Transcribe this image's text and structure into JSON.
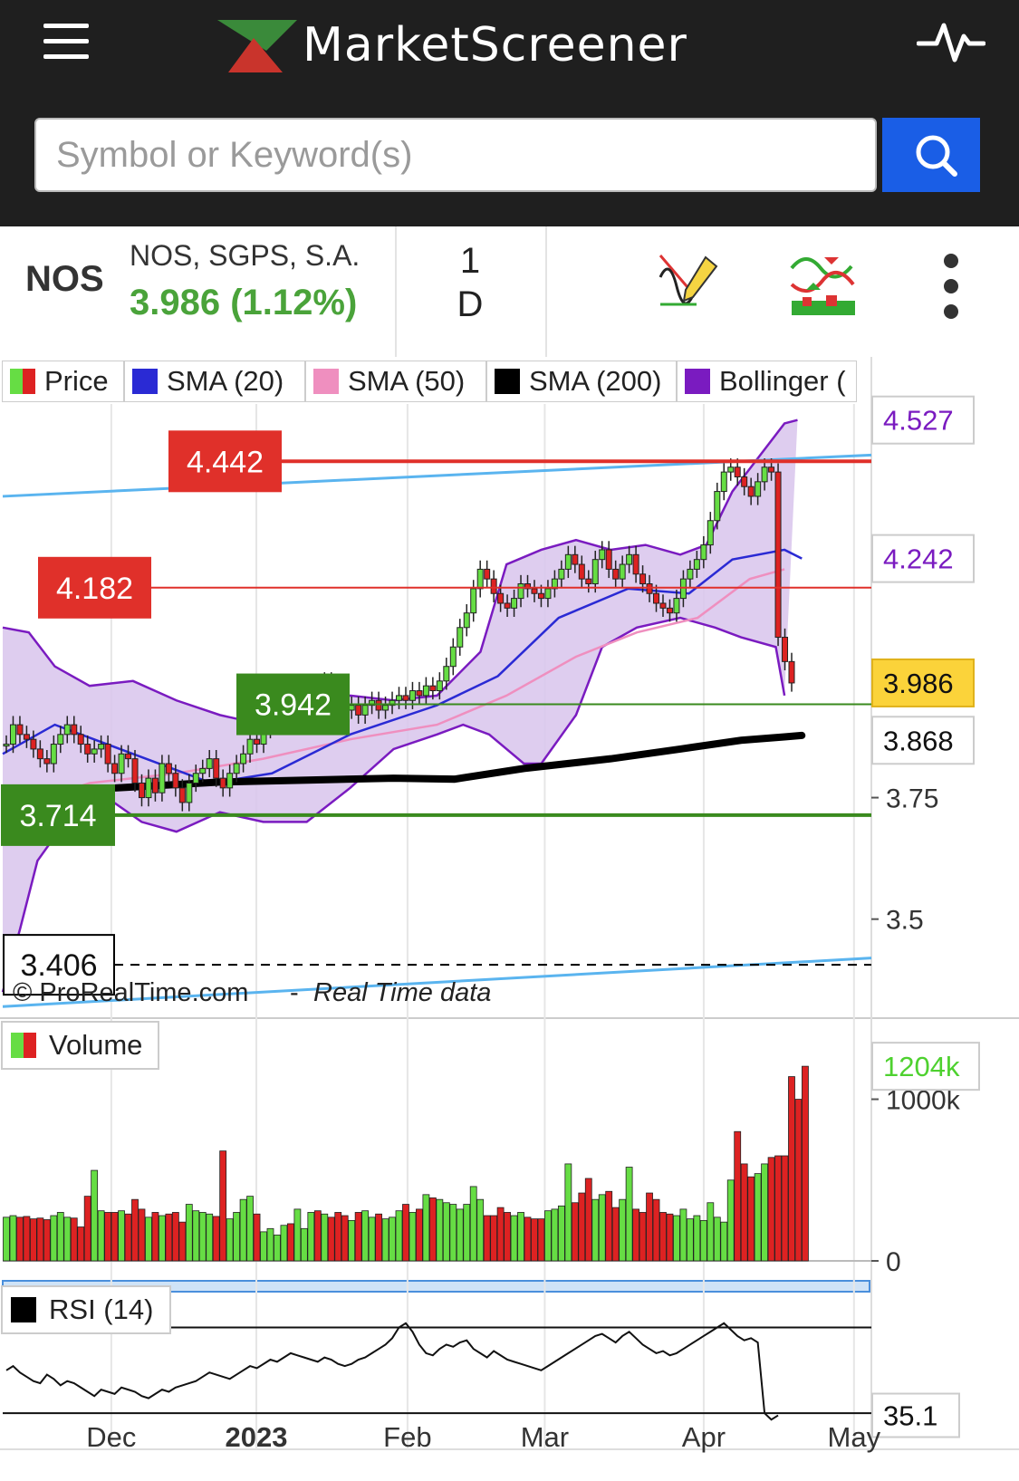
{
  "header": {
    "brand": "MarketScreener",
    "search_placeholder": "Symbol or Keyword(s)"
  },
  "instrument": {
    "ticker": "NOS",
    "name": "NOS, SGPS, S.A.",
    "price_change": "3.986 (1.12%)",
    "period_top": "1",
    "period_bottom": "D"
  },
  "legend": [
    "Price",
    "SMA (20)",
    "SMA (50)",
    "SMA (200)",
    "Bollinger ("
  ],
  "colors": {
    "up": "#66dd44",
    "down": "#dd2222",
    "sma20": "#2a2ad4",
    "sma50": "#ef8fbf",
    "sma200": "#000000",
    "bollinger": "#7a1bc0",
    "band_fill": "#d8c4ec",
    "channel": "#5ab4ef",
    "resistance": "#e0302a",
    "support": "#3a8a1e",
    "accent": "#1a5ee6"
  },
  "watermark": {
    "copyright": "© ProRealTime.com",
    "dash": "-",
    "realtime": "Real Time data"
  },
  "volume_label": "Volume",
  "rsi_label": "RSI (14)",
  "icons": [
    "menu-icon",
    "pulse-icon",
    "search-icon",
    "drawing-tool-icon",
    "indicators-icon",
    "more-vertical-icon"
  ],
  "chart_data": {
    "type": "candlestick",
    "price": {
      "ylim": [
        3.3,
        4.56
      ],
      "y_ticks": [
        {
          "v": 3.75,
          "label": "3.75"
        },
        {
          "v": 3.5,
          "label": "3.5"
        }
      ],
      "right_labels": [
        {
          "v": 4.527,
          "label": "4.527",
          "kind": "bollinger"
        },
        {
          "v": 4.242,
          "label": "4.242",
          "kind": "bollinger"
        },
        {
          "v": 3.986,
          "label": "3.986",
          "kind": "last"
        },
        {
          "v": 3.868,
          "label": "3.868",
          "kind": "plain"
        }
      ],
      "levels": [
        {
          "v": 4.442,
          "label": "4.442",
          "kind": "resistance",
          "tag_from": 187,
          "tag_to": 310,
          "line_from": 310,
          "width": 4
        },
        {
          "v": 4.182,
          "label": "4.182",
          "kind": "resistance",
          "tag_from": 43,
          "tag_to": 166,
          "line_from": 166,
          "width": 2
        },
        {
          "v": 3.942,
          "label": "3.942",
          "kind": "support",
          "tag_from": 262,
          "tag_to": 385,
          "line_from": 385,
          "width": 2
        },
        {
          "v": 3.714,
          "label": "3.714",
          "kind": "support",
          "tag_from": 2,
          "tag_to": 126,
          "line_from": 126,
          "width": 4
        },
        {
          "v": 3.406,
          "label": "3.406",
          "kind": "dashed",
          "tag_from": 4,
          "tag_to": 126,
          "line_from": 126,
          "width": 2
        }
      ],
      "channel_upper": [
        [
          0,
          4.37
        ],
        [
          1,
          4.455
        ]
      ],
      "channel_lower": [
        [
          0,
          3.32
        ],
        [
          1,
          3.42
        ]
      ]
    },
    "x_labels": [
      {
        "t": 0.125,
        "label": "Dec",
        "bold": false
      },
      {
        "t": 0.292,
        "label": "2023",
        "bold": true
      },
      {
        "t": 0.466,
        "label": "Feb",
        "bold": false
      },
      {
        "t": 0.624,
        "label": "Mar",
        "bold": false
      },
      {
        "t": 0.807,
        "label": "Apr",
        "bold": false
      },
      {
        "t": 0.98,
        "label": "May",
        "bold": false
      }
    ],
    "closes": [
      3.86,
      3.9,
      3.88,
      3.87,
      3.85,
      3.83,
      3.82,
      3.86,
      3.88,
      3.9,
      3.88,
      3.86,
      3.84,
      3.85,
      3.86,
      3.82,
      3.8,
      3.84,
      3.83,
      3.78,
      3.75,
      3.79,
      3.76,
      3.82,
      3.8,
      3.77,
      3.74,
      3.78,
      3.8,
      3.81,
      3.83,
      3.79,
      3.77,
      3.8,
      3.82,
      3.84,
      3.87,
      3.86,
      3.89,
      3.9,
      3.91,
      3.93,
      3.92,
      3.94,
      3.96,
      3.98,
      3.97,
      3.99,
      3.98,
      3.95,
      3.93,
      3.94,
      3.92,
      3.94,
      3.95,
      3.93,
      3.94,
      3.95,
      3.96,
      3.95,
      3.97,
      3.96,
      3.98,
      3.97,
      3.99,
      4.02,
      4.06,
      4.1,
      4.13,
      4.18,
      4.22,
      4.2,
      4.17,
      4.15,
      4.14,
      4.16,
      4.19,
      4.18,
      4.17,
      4.16,
      4.18,
      4.2,
      4.22,
      4.25,
      4.23,
      4.2,
      4.19,
      4.24,
      4.26,
      4.22,
      4.2,
      4.23,
      4.25,
      4.21,
      4.19,
      4.17,
      4.15,
      4.14,
      4.13,
      4.16,
      4.2,
      4.22,
      4.24,
      4.27,
      4.32,
      4.38,
      4.42,
      4.43,
      4.41,
      4.39,
      4.37,
      4.4,
      4.43,
      4.42,
      4.08,
      4.03,
      3.986
    ],
    "sma20": [
      [
        0,
        3.84
      ],
      [
        0.06,
        3.9
      ],
      [
        0.15,
        3.84
      ],
      [
        0.24,
        3.78
      ],
      [
        0.31,
        3.8
      ],
      [
        0.4,
        3.88
      ],
      [
        0.5,
        3.94
      ],
      [
        0.57,
        4.0
      ],
      [
        0.64,
        4.12
      ],
      [
        0.72,
        4.18
      ],
      [
        0.79,
        4.17
      ],
      [
        0.84,
        4.24
      ],
      [
        0.9,
        4.26
      ],
      [
        0.92,
        4.242
      ]
    ],
    "sma50": [
      [
        0,
        3.72
      ],
      [
        0.1,
        3.78
      ],
      [
        0.2,
        3.8
      ],
      [
        0.3,
        3.83
      ],
      [
        0.4,
        3.87
      ],
      [
        0.5,
        3.9
      ],
      [
        0.58,
        3.96
      ],
      [
        0.66,
        4.04
      ],
      [
        0.73,
        4.09
      ],
      [
        0.8,
        4.12
      ],
      [
        0.86,
        4.2
      ],
      [
        0.9,
        4.22
      ]
    ],
    "sma200": [
      [
        0.13,
        3.77
      ],
      [
        0.25,
        3.782
      ],
      [
        0.35,
        3.786
      ],
      [
        0.45,
        3.79
      ],
      [
        0.52,
        3.788
      ],
      [
        0.6,
        3.81
      ],
      [
        0.7,
        3.83
      ],
      [
        0.78,
        3.85
      ],
      [
        0.85,
        3.868
      ],
      [
        0.9,
        3.875
      ],
      [
        0.92,
        3.878
      ]
    ],
    "boll_upper": [
      [
        0,
        4.1
      ],
      [
        0.03,
        4.09
      ],
      [
        0.06,
        4.02
      ],
      [
        0.1,
        3.98
      ],
      [
        0.15,
        3.99
      ],
      [
        0.2,
        3.95
      ],
      [
        0.25,
        3.92
      ],
      [
        0.3,
        3.9
      ],
      [
        0.35,
        3.93
      ],
      [
        0.4,
        3.96
      ],
      [
        0.45,
        3.95
      ],
      [
        0.5,
        3.96
      ],
      [
        0.55,
        4.05
      ],
      [
        0.58,
        4.23
      ],
      [
        0.62,
        4.26
      ],
      [
        0.66,
        4.28
      ],
      [
        0.7,
        4.26
      ],
      [
        0.74,
        4.27
      ],
      [
        0.78,
        4.25
      ],
      [
        0.81,
        4.27
      ],
      [
        0.84,
        4.38
      ],
      [
        0.87,
        4.45
      ],
      [
        0.9,
        4.52
      ],
      [
        0.915,
        4.527
      ]
    ],
    "boll_lower": [
      [
        0,
        3.35
      ],
      [
        0.02,
        3.48
      ],
      [
        0.04,
        3.62
      ],
      [
        0.08,
        3.72
      ],
      [
        0.12,
        3.75
      ],
      [
        0.16,
        3.7
      ],
      [
        0.2,
        3.68
      ],
      [
        0.25,
        3.72
      ],
      [
        0.3,
        3.7
      ],
      [
        0.35,
        3.7
      ],
      [
        0.4,
        3.77
      ],
      [
        0.45,
        3.85
      ],
      [
        0.5,
        3.88
      ],
      [
        0.53,
        3.9
      ],
      [
        0.56,
        3.88
      ],
      [
        0.6,
        3.82
      ],
      [
        0.62,
        3.82
      ],
      [
        0.66,
        3.92
      ],
      [
        0.69,
        4.06
      ],
      [
        0.73,
        4.1
      ],
      [
        0.78,
        4.12
      ],
      [
        0.82,
        4.1
      ],
      [
        0.85,
        4.08
      ],
      [
        0.89,
        4.06
      ],
      [
        0.9,
        3.96
      ]
    ],
    "volume": {
      "ylim": [
        0,
        1300
      ],
      "y_ticks": [
        {
          "v": 1000,
          "label": "1000k"
        },
        {
          "v": 0,
          "label": "0"
        }
      ],
      "last_label": "1204k",
      "bars": [
        270,
        280,
        270,
        275,
        260,
        265,
        255,
        280,
        300,
        270,
        265,
        210,
        400,
        560,
        310,
        300,
        300,
        310,
        290,
        380,
        320,
        270,
        300,
        280,
        290,
        300,
        240,
        350,
        310,
        300,
        290,
        275,
        680,
        260,
        300,
        380,
        400,
        290,
        180,
        200,
        160,
        220,
        230,
        320,
        200,
        300,
        310,
        290,
        270,
        300,
        280,
        250,
        300,
        310,
        270,
        290,
        260,
        270,
        310,
        350,
        300,
        320,
        410,
        390,
        380,
        360,
        350,
        320,
        350,
        460,
        380,
        280,
        280,
        330,
        300,
        280,
        300,
        270,
        260,
        260,
        310,
        320,
        340,
        600,
        360,
        420,
        510,
        380,
        410,
        430,
        330,
        380,
        580,
        320,
        300,
        420,
        380,
        300,
        290,
        280,
        320,
        260,
        280,
        250,
        360,
        270,
        240,
        500,
        800,
        600,
        520,
        540,
        600,
        640,
        650,
        650,
        1140,
        1000,
        1204
      ],
      "colors_from_closes": true
    },
    "rsi": {
      "value_label": "35.1",
      "ylim": [
        25,
        85
      ],
      "levels": [
        70,
        30
      ],
      "values": [
        50,
        52,
        49,
        47,
        45,
        44,
        48,
        46,
        43,
        45,
        44,
        42,
        40,
        38,
        41,
        40,
        39,
        42,
        41,
        40,
        38,
        37,
        39,
        41,
        40,
        42,
        43,
        44,
        45,
        47,
        49,
        48,
        47,
        46,
        48,
        50,
        52,
        51,
        53,
        55,
        54,
        56,
        58,
        57,
        56,
        55,
        54,
        56,
        55,
        53,
        52,
        53,
        55,
        56,
        58,
        60,
        62,
        65,
        70,
        72,
        68,
        62,
        58,
        57,
        60,
        62,
        61,
        63,
        64,
        60,
        58,
        56,
        59,
        57,
        55,
        54,
        53,
        52,
        51,
        50,
        52,
        54,
        56,
        58,
        60,
        62,
        64,
        66,
        67,
        65,
        63,
        66,
        68,
        65,
        62,
        60,
        58,
        59,
        57,
        58,
        60,
        62,
        64,
        66,
        68,
        70,
        72,
        69,
        66,
        64,
        65,
        63,
        30,
        27,
        29
      ]
    }
  }
}
